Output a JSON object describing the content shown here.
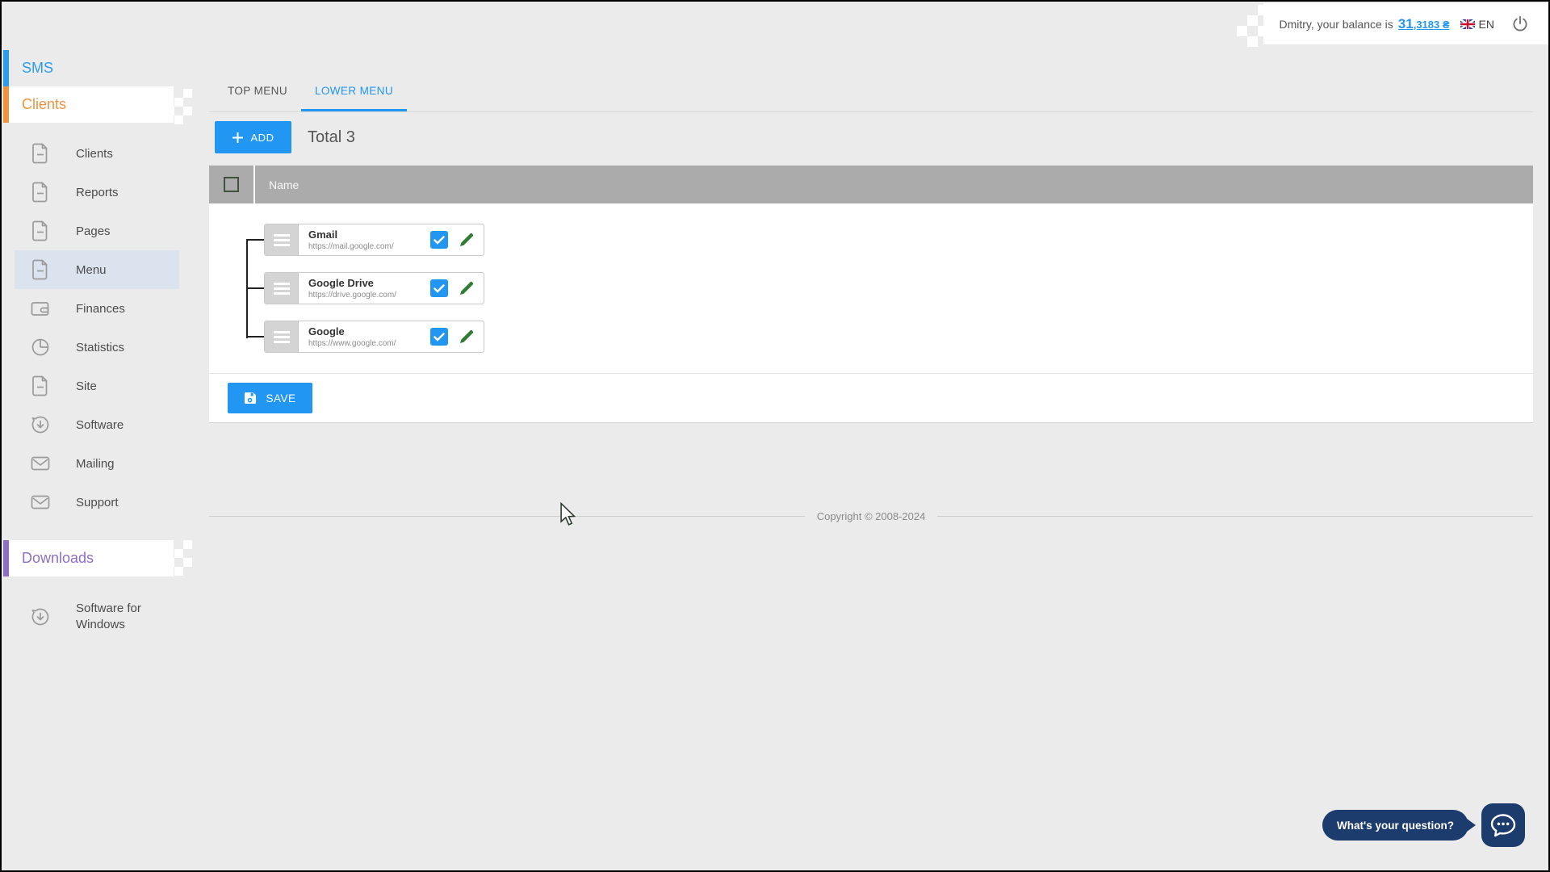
{
  "header": {
    "balance_prefix": "Dmitry, your balance is",
    "balance_int": "31",
    "balance_frac": ",3183 ₴",
    "lang": "EN"
  },
  "sidebar": {
    "sms_label": "SMS",
    "clients_label": "Clients",
    "downloads_label": "Downloads",
    "nav": [
      {
        "label": "Clients"
      },
      {
        "label": "Reports"
      },
      {
        "label": "Pages"
      },
      {
        "label": "Menu"
      },
      {
        "label": "Finances"
      },
      {
        "label": "Statistics"
      },
      {
        "label": "Site"
      },
      {
        "label": "Software"
      },
      {
        "label": "Mailing"
      },
      {
        "label": "Support"
      }
    ],
    "downloads_nav": [
      {
        "label": "Software for Windows"
      }
    ]
  },
  "main": {
    "tabs": [
      {
        "label": "TOP MENU"
      },
      {
        "label": "LOWER MENU"
      }
    ],
    "add_label": "ADD",
    "total_label": "Total 3",
    "table": {
      "name_header": "Name"
    },
    "menu_items": [
      {
        "name": "Gmail",
        "url": "https://mail.google.com/",
        "visible": true
      },
      {
        "name": "Google Drive",
        "url": "https://drive.google.com/",
        "visible": true
      },
      {
        "name": "Google",
        "url": "https://www.google.com/",
        "visible": true
      }
    ],
    "save_label": "SAVE"
  },
  "footer": {
    "copyright": "Copyright © 2008-2024"
  },
  "chat": {
    "question": "What's your question?"
  },
  "colors": {
    "accent": "#2196f3",
    "sms_blue": "#2e9ced",
    "clients_orange": "#f0923e",
    "downloads_purple": "#8d6fc4",
    "chat_navy": "#1c3c6e",
    "pencil_green": "#2e7d32",
    "table_header_gray": "#ababab"
  }
}
